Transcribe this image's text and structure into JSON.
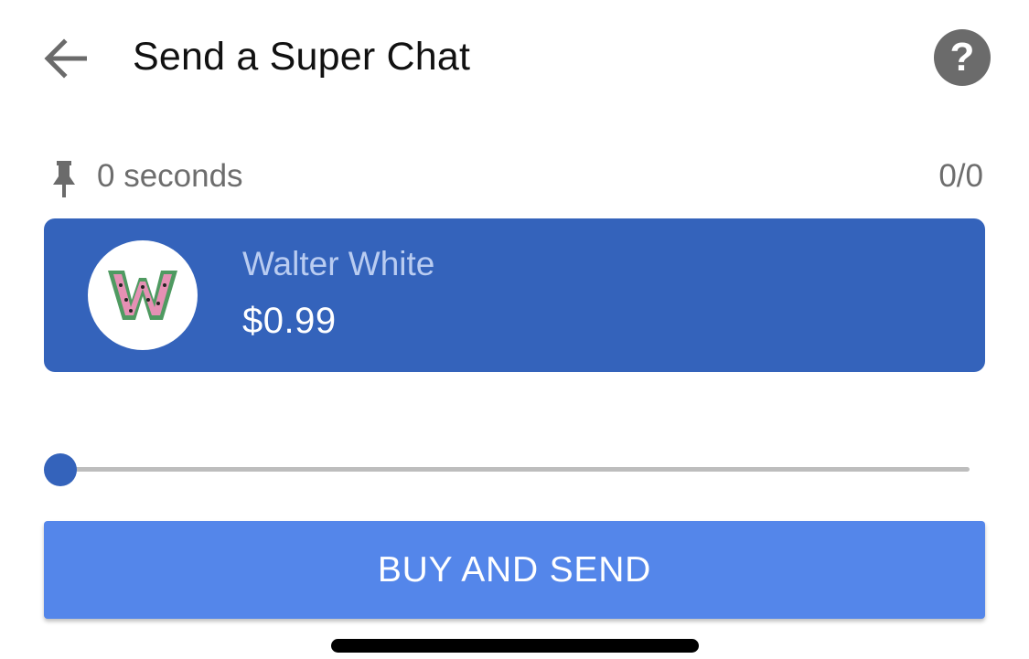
{
  "header": {
    "title": "Send a Super Chat",
    "back_icon": "arrow-left-icon",
    "help_icon": "help-circle-icon",
    "help_glyph": "?"
  },
  "meta": {
    "pin_icon": "pin-icon",
    "duration": "0 seconds",
    "counter": "0/0"
  },
  "card": {
    "name": "Walter White",
    "amount": "$0.99",
    "avatar_icon": "watermelon-w-avatar",
    "background_color": "#3463bb",
    "name_color": "#b9ccf1"
  },
  "slider": {
    "value_fraction": 0,
    "thumb_color": "#3463bb"
  },
  "button": {
    "label": "BUY AND SEND",
    "color": "#5486ea"
  }
}
